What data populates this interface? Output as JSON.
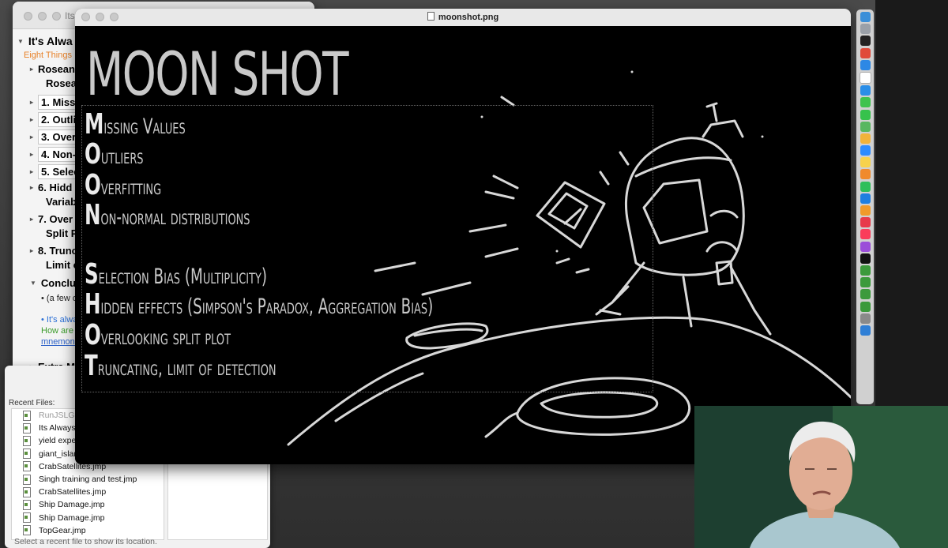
{
  "journal": {
    "title": "Its",
    "heading": "It's Alwa",
    "subtitle": "Eight Things",
    "items": [
      {
        "label": "Rosean",
        "label2": "Rosean"
      },
      {
        "label": "1. Missi"
      },
      {
        "label": "2. Outli"
      },
      {
        "label": "3. Over"
      },
      {
        "label": "4. Non-"
      },
      {
        "label": "5. Selec"
      },
      {
        "label": "6. Hidd",
        "label2": "Variable"
      },
      {
        "label": "7. Over",
        "label2": "Split Pl"
      },
      {
        "label": "8. Trunc",
        "label2": "Limit of"
      },
      {
        "label": "Conclus"
      },
      {
        "label": "Extra M"
      }
    ],
    "conclusion_note": "• (a few of t",
    "blue_text": "• It's always",
    "green_text": "How are we",
    "link_text": "mnemonic"
  },
  "recent": {
    "header": "Recent Files:",
    "files": [
      "RunJSLGUI",
      "Its Always S",
      "yield experi",
      "giant_island",
      "CrabSatellites.jmp",
      "Singh training and test.jmp",
      "CrabSatellites.jmp",
      "Ship Damage.jmp",
      "Ship Damage.jmp",
      "TopGear.jmp"
    ],
    "status": "Select a recent file to show its location."
  },
  "preview": {
    "filename": "moonshot.png",
    "title": "MOON SHOT",
    "lines": [
      {
        "cap": "M",
        "rest": "issing Values"
      },
      {
        "cap": "O",
        "rest": "utliers"
      },
      {
        "cap": "O",
        "rest": "verfitting"
      },
      {
        "cap": "N",
        "rest": "on-normal distributions"
      },
      {
        "cap": "S",
        "rest": "election Bias (Multiplicity)"
      },
      {
        "cap": "H",
        "rest": "idden effects (Simpson's Paradox, Aggregation Bias)"
      },
      {
        "cap": "O",
        "rest": "verlooking split plot"
      },
      {
        "cap": "T",
        "rest": "runcating, limit of detection"
      }
    ]
  },
  "dock": {
    "icons": [
      "finder-icon",
      "launchpad-icon",
      "terminal-icon",
      "chrome-icon",
      "mail-icon",
      "calendar-icon",
      "safari-icon",
      "messages-icon",
      "facetime-icon",
      "maps-icon",
      "photos-icon",
      "zoom-icon",
      "notes-icon",
      "books-icon",
      "numbers-icon",
      "keynote-icon",
      "pages-icon",
      "news-icon",
      "music-icon",
      "podcasts-icon",
      "tv-icon",
      "jmp-icon",
      "jmp-icon",
      "jmp-icon",
      "jmp-icon",
      "help-icon",
      "xcode-icon"
    ],
    "colors": [
      "#3b8fd8",
      "#9aa0a8",
      "#222222",
      "#e04a3a",
      "#2d88e5",
      "#ffffff",
      "#2a8ee8",
      "#3ec34e",
      "#36c24c",
      "#58b760",
      "#f2b33b",
      "#2d8cff",
      "#f7d24c",
      "#f08a2c",
      "#2fbf5a",
      "#1f7fe0",
      "#f09a2a",
      "#e73a4a",
      "#fa3c5a",
      "#9b4ed9",
      "#111111",
      "#3c9a3c",
      "#3c9a3c",
      "#3c9a3c",
      "#3c9a3c",
      "#8a8a8a",
      "#2f7fd6"
    ]
  }
}
